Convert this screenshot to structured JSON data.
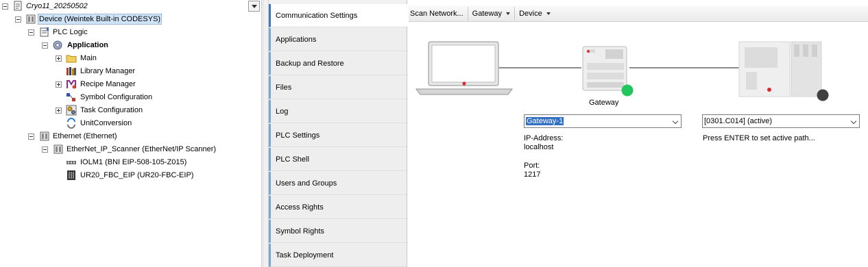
{
  "tree": {
    "nodes": [
      {
        "label": "Cryo11_20250502",
        "icon": "project-icon"
      },
      {
        "label": "Device (Weintek Built-in CODESYS)",
        "icon": "device-icon"
      },
      {
        "label": "PLC Logic",
        "icon": "plc-logic-icon"
      },
      {
        "label": "Application",
        "icon": "application-gear-icon"
      },
      {
        "label": "Main",
        "icon": "folder-icon"
      },
      {
        "label": "Library Manager",
        "icon": "library-icon"
      },
      {
        "label": "Recipe Manager",
        "icon": "recipe-icon"
      },
      {
        "label": "Symbol Configuration",
        "icon": "symbol-config-icon"
      },
      {
        "label": "Task Configuration",
        "icon": "task-config-icon"
      },
      {
        "label": "UnitConversion",
        "icon": "unit-conversion-icon"
      },
      {
        "label": "Ethernet (Ethernet)",
        "icon": "ethernet-icon"
      },
      {
        "label": "EtherNet_IP_Scanner (EtherNet/IP Scanner)",
        "icon": "scanner-icon"
      },
      {
        "label": "IOLM1 (BNI EIP-508-105-Z015)",
        "icon": "iolm-icon"
      },
      {
        "label": "UR20_FBC_EIP (UR20-FBC-EIP)",
        "icon": "io-module-icon"
      }
    ]
  },
  "tabs": [
    {
      "label": "Communication Settings"
    },
    {
      "label": "Applications"
    },
    {
      "label": "Backup and Restore"
    },
    {
      "label": "Files"
    },
    {
      "label": "Log"
    },
    {
      "label": "PLC Settings"
    },
    {
      "label": "PLC Shell"
    },
    {
      "label": "Users and Groups"
    },
    {
      "label": "Access Rights"
    },
    {
      "label": "Symbol Rights"
    },
    {
      "label": "Task Deployment"
    }
  ],
  "toolbar": {
    "scan_label": "Scan Network...",
    "gateway_label": "Gateway",
    "device_label": "Device"
  },
  "network": {
    "gateway_caption": "Gateway",
    "gateway_combo": "Gateway-1",
    "gateway_ip_label": "IP-Address:",
    "gateway_ip_value": "localhost",
    "gateway_port_label": "Port:",
    "gateway_port_value": "1217",
    "device_combo": "[0301.C014] (active)",
    "device_hint": "Press ENTER to set active path...",
    "gateway_status_color": "#22c55e",
    "device_status_color": "#404040"
  }
}
